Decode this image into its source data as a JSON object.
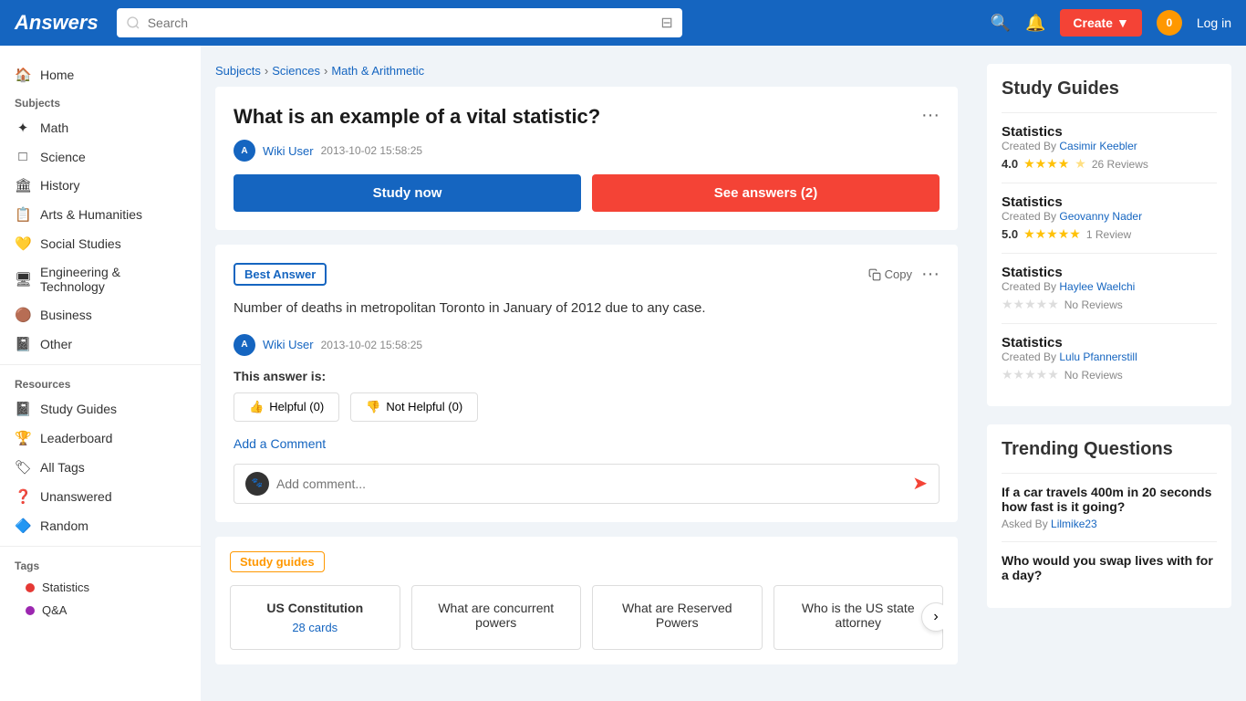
{
  "header": {
    "logo": "Answers",
    "search_placeholder": "Search",
    "create_label": "Create",
    "notification_count": "0",
    "login_label": "Log in"
  },
  "sidebar": {
    "home_label": "Home",
    "subjects_label": "Subjects",
    "items": [
      {
        "id": "math",
        "label": "Math",
        "icon": "✦"
      },
      {
        "id": "science",
        "label": "Science",
        "icon": "□"
      },
      {
        "id": "history",
        "label": "History",
        "icon": "🏛"
      },
      {
        "id": "arts",
        "label": "Arts & Humanities",
        "icon": "📋"
      },
      {
        "id": "social",
        "label": "Social Studies",
        "icon": "💛"
      },
      {
        "id": "engineering",
        "label": "Engineering & Technology",
        "icon": "🖥"
      },
      {
        "id": "business",
        "label": "Business",
        "icon": "🟤"
      },
      {
        "id": "other",
        "label": "Other",
        "icon": "📓"
      }
    ],
    "resources_label": "Resources",
    "resources": [
      {
        "id": "study-guides",
        "label": "Study Guides",
        "icon": "📓"
      },
      {
        "id": "leaderboard",
        "label": "Leaderboard",
        "icon": "🏆"
      },
      {
        "id": "all-tags",
        "label": "All Tags",
        "icon": "🏷"
      },
      {
        "id": "unanswered",
        "label": "Unanswered",
        "icon": "❓"
      },
      {
        "id": "random",
        "label": "Random",
        "icon": "🔷"
      }
    ],
    "tags_label": "Tags",
    "tags": [
      {
        "id": "statistics",
        "label": "Statistics",
        "color": "red"
      },
      {
        "id": "qa",
        "label": "Q&A",
        "color": "purple"
      }
    ]
  },
  "breadcrumb": {
    "items": [
      "Subjects",
      "Sciences",
      "Math & Arithmetic"
    ]
  },
  "question": {
    "title": "What is an example of a vital statistic?",
    "author": "Wiki User",
    "date": "2013-10-02 15:58:25",
    "study_now_label": "Study now",
    "see_answers_label": "See answers (2)"
  },
  "answer": {
    "best_answer_label": "Best Answer",
    "copy_label": "Copy",
    "text": "Number of deaths in metropolitan Toronto in January of 2012 due to any case.",
    "author": "Wiki User",
    "date": "2013-10-02 15:58:25",
    "this_answer_label": "This answer is:",
    "helpful_label": "Helpful (0)",
    "not_helpful_label": "Not Helpful (0)",
    "add_comment_label": "Add a Comment",
    "comment_placeholder": "Add comment..."
  },
  "study_guides_section": {
    "label": "Study guides",
    "cards": [
      {
        "title": "US Constitution",
        "sub": "28 cards",
        "type": "cards"
      },
      {
        "title": "What are concurrent powers",
        "sub": "",
        "type": "question"
      },
      {
        "title": "What are Reserved Powers",
        "sub": "",
        "type": "question"
      },
      {
        "title": "Who is the US state attorney",
        "sub": "",
        "type": "question"
      }
    ]
  },
  "right_panel": {
    "study_guides_title": "Study Guides",
    "entries": [
      {
        "title": "Statistics",
        "creator_label": "Created By",
        "creator": "Casimir Keebler",
        "rating": "4.0",
        "stars_filled": 4,
        "stars_empty": 1,
        "reviews": "26 Reviews"
      },
      {
        "title": "Statistics",
        "creator_label": "Created By",
        "creator": "Geovanny Nader",
        "rating": "5.0",
        "stars_filled": 5,
        "stars_empty": 0,
        "reviews": "1 Review"
      },
      {
        "title": "Statistics",
        "creator_label": "Created By",
        "creator": "Haylee Waelchi",
        "rating": "",
        "stars_filled": 0,
        "stars_empty": 5,
        "reviews": "No Reviews"
      },
      {
        "title": "Statistics",
        "creator_label": "Created By",
        "creator": "Lulu Pfannerstill",
        "rating": "",
        "stars_filled": 0,
        "stars_empty": 5,
        "reviews": "No Reviews"
      }
    ],
    "trending_title": "Trending Questions",
    "trending": [
      {
        "question": "If a car travels 400m in 20 seconds how fast is it going?",
        "asked_by_label": "Asked By",
        "user": "Lilmike23"
      },
      {
        "question": "Who would you swap lives with for a day?",
        "asked_by_label": "",
        "user": ""
      }
    ]
  }
}
